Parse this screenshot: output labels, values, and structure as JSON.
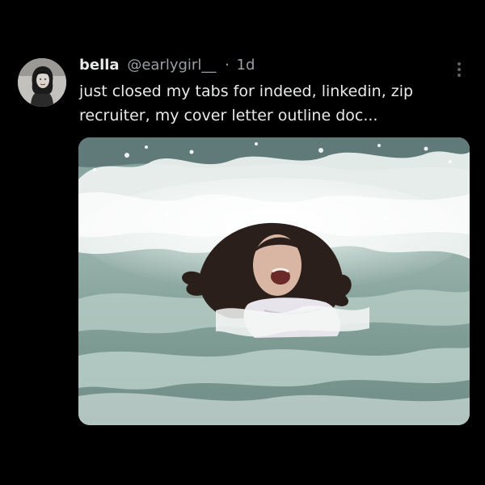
{
  "tweet": {
    "author": {
      "display_name": "bella",
      "handle": "@earlygirl__",
      "separator": "·",
      "timestamp": "1d",
      "avatar_icon": "profile-photo"
    },
    "text_lines": [
      "just closed my tabs for indeed, linkedin, zip",
      "recruiter, my cover letter outline doc..."
    ],
    "menu_icon": "more-vertical-icon",
    "media": {
      "kind": "photo",
      "subject": "person-in-crashing-waves"
    }
  },
  "colors": {
    "background": "#000000",
    "primary_text": "#e7e9ea",
    "secondary_text": "#9b9ea3",
    "water": "#8ea8a1",
    "foam": "#f2f5f4"
  }
}
